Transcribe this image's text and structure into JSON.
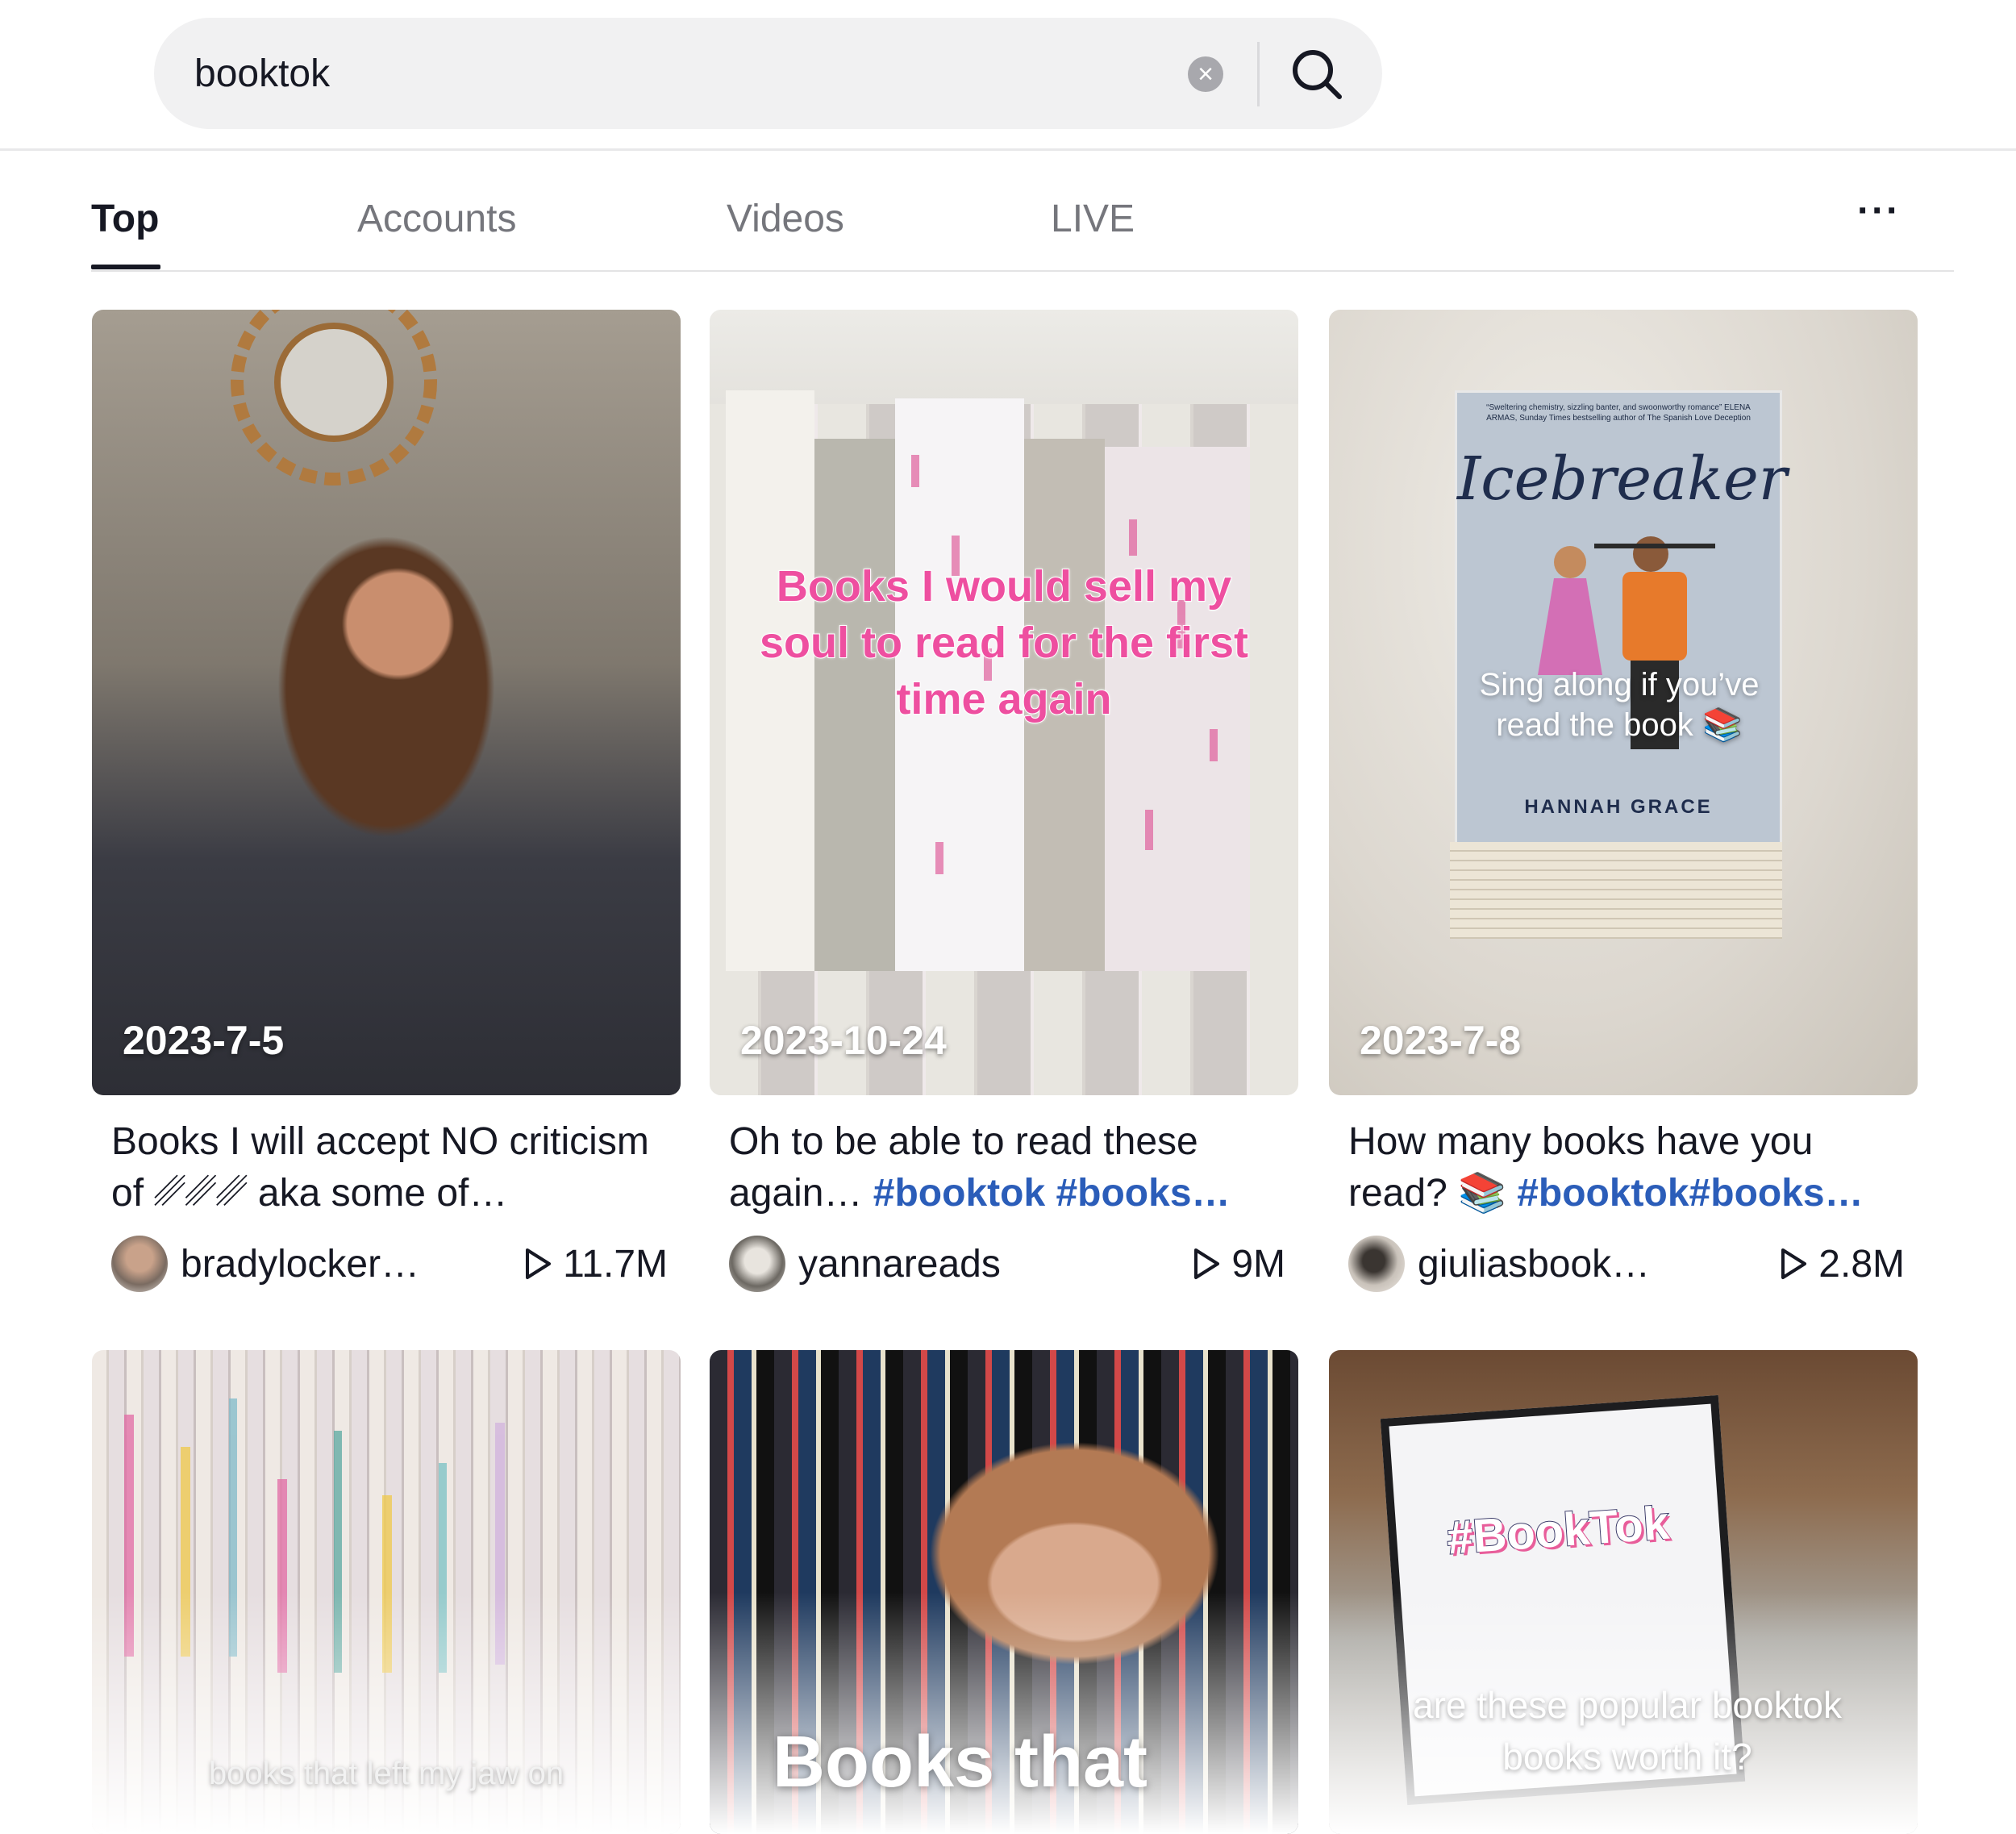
{
  "search": {
    "value": "booktok",
    "clear_icon": "clear-icon",
    "search_icon": "search-icon"
  },
  "tabs": [
    {
      "label": "Top",
      "active": true
    },
    {
      "label": "Accounts",
      "active": false
    },
    {
      "label": "Videos",
      "active": false
    },
    {
      "label": "LIVE",
      "active": false
    }
  ],
  "more_label": "···",
  "cards": [
    {
      "date": "2023-7-5",
      "desc_text": "Books I will accept NO criticism of ␥␥␥ aka some of…",
      "author": "bradylocker…",
      "views": "11.7M",
      "overlay": ""
    },
    {
      "date": "2023-10-24",
      "desc_text": "Oh to be able to read these again… ",
      "desc_tags": "#booktok #books…",
      "author": "yannareads",
      "views": "9M",
      "overlay": "Books I would sell my soul to read for the first time again"
    },
    {
      "date": "2023-7-8",
      "desc_text": "How many books have you read? 📚 ",
      "desc_tags": "#booktok#books…",
      "author": "giuliasbook…",
      "views": "2.8M",
      "overlay": "Sing along if you’ve read the book 📚",
      "cover_title": "Icebreaker",
      "cover_author": "HANNAH GRACE",
      "cover_blurb": "“Sweltering chemistry, sizzling banter, and swoonworthy romance” ELENA ARMAS, Sunday Times bestselling author of The Spanish Love Deception"
    },
    {
      "overlay": "books that left my jaw on"
    },
    {
      "overlay": "Books that"
    },
    {
      "overlay": "are these popular booktok books worth it?",
      "sign_text": "#BookTok"
    }
  ],
  "colors": {
    "accent_tag": "#2b5db9",
    "text": "#161823",
    "muted": "#75767c",
    "pink_overlay": "#ee4fa0"
  }
}
